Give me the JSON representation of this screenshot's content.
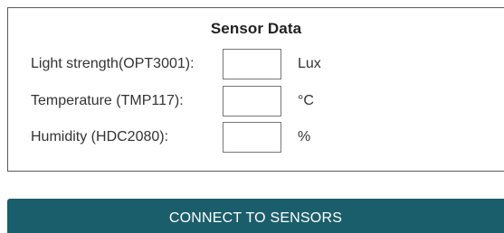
{
  "panel": {
    "title": "Sensor Data",
    "rows": [
      {
        "label": "Light strength(OPT3001):",
        "value": "",
        "unit": "Lux"
      },
      {
        "label": "Temperature (TMP117):",
        "value": "",
        "unit": "°C"
      },
      {
        "label": "Humidity (HDC2080):",
        "value": "",
        "unit": "%"
      }
    ]
  },
  "actions": {
    "connect_label": "CONNECT TO SENSORS"
  },
  "colors": {
    "button_bg": "#1b5e6b",
    "button_text": "#ffffff",
    "panel_border": "#5a5a5a"
  }
}
